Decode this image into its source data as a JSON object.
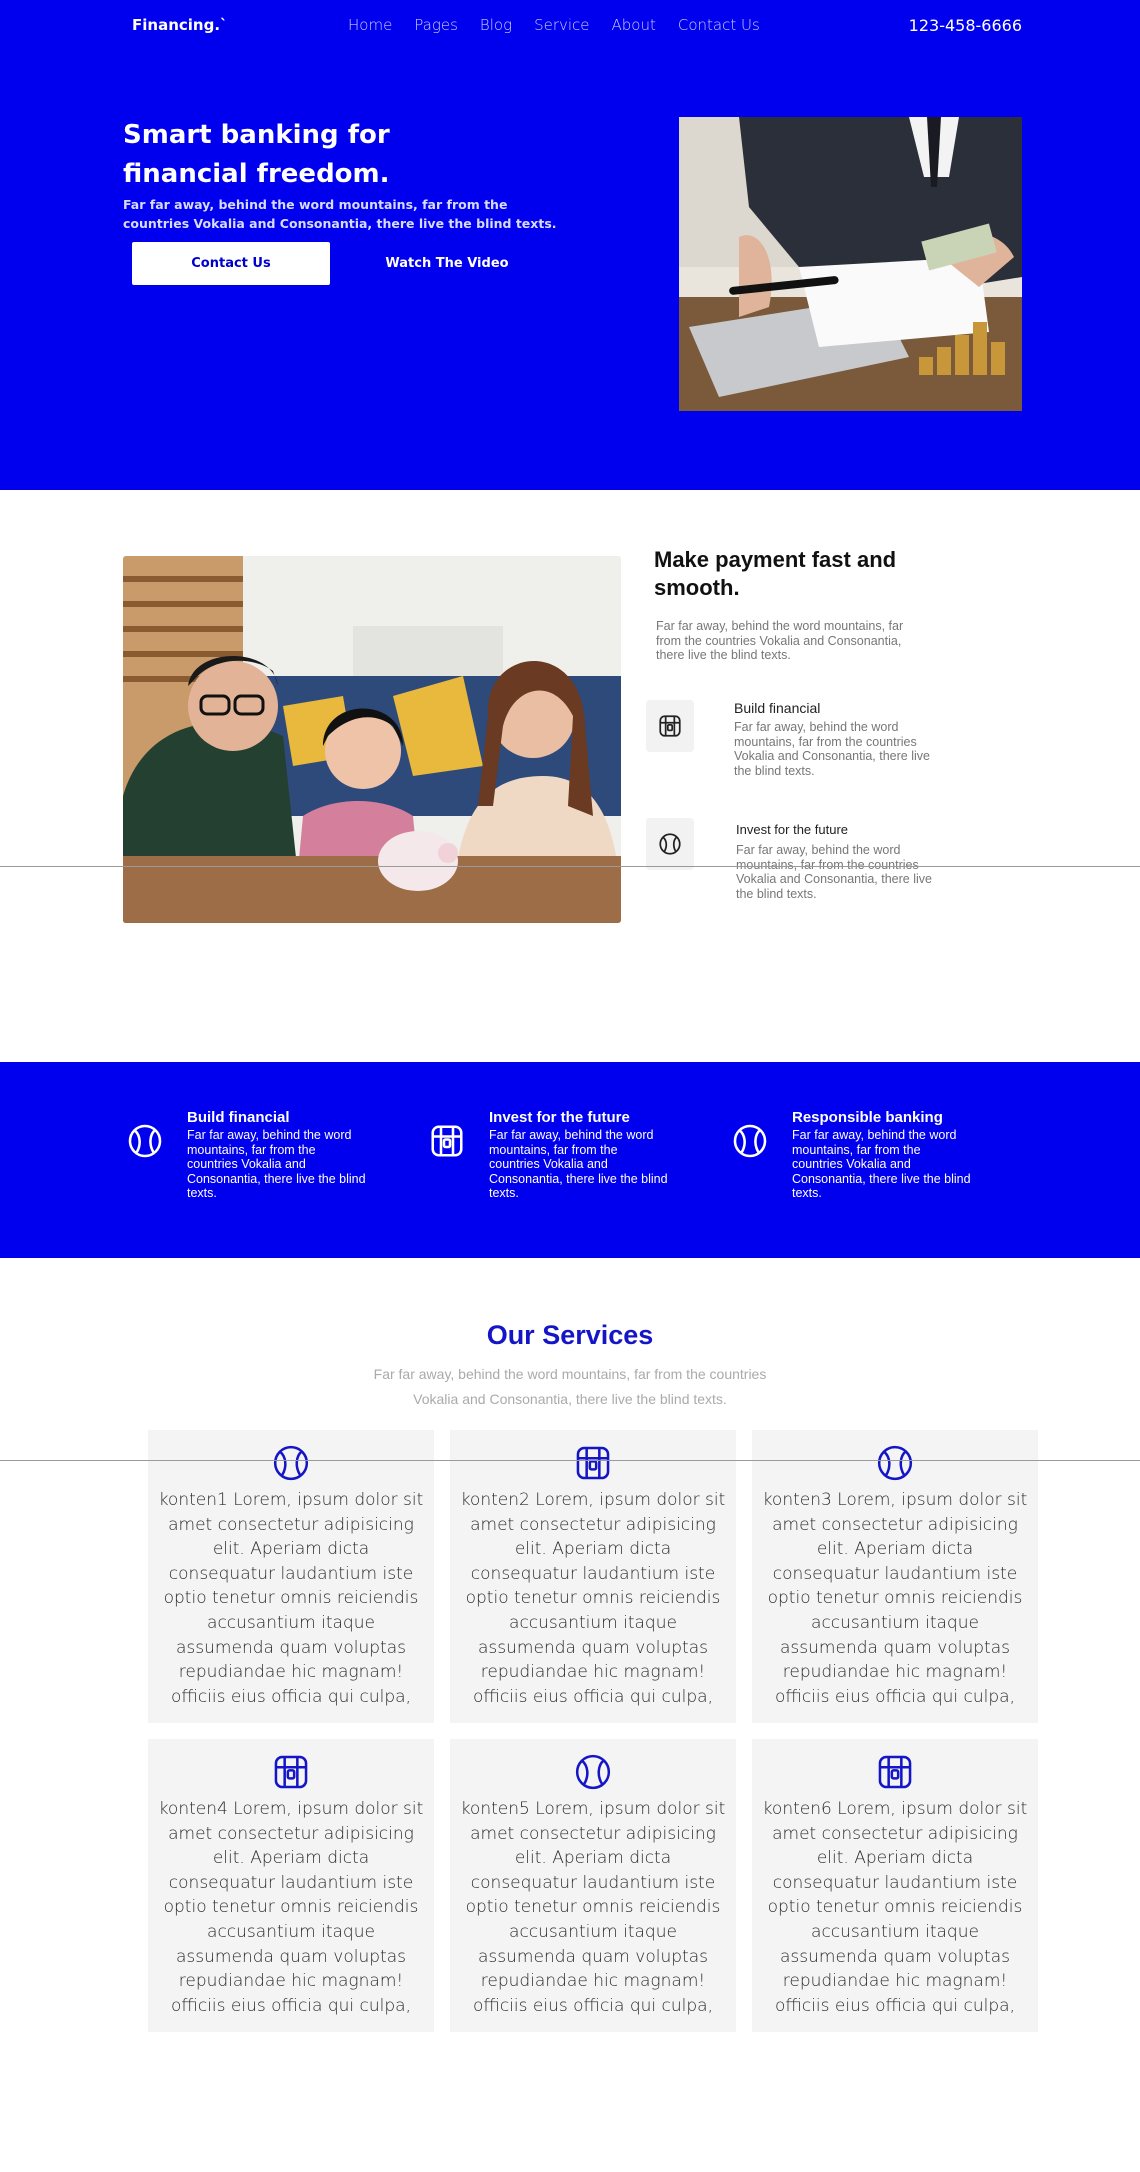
{
  "colors": {
    "brand_blue": "#0000ee",
    "heading_blue": "#1515c8",
    "card_bg": "#f4f4f4"
  },
  "header": {
    "brand": "Financing.`",
    "nav": [
      "Home",
      "Pages",
      "Blog",
      "Service",
      "About",
      "Contact Us"
    ],
    "phone": "123-458-6666"
  },
  "hero": {
    "title": "Smart banking for financial freedom.",
    "subtitle": "Far far away, behind the word mountains, far from the countries Vokalia and Consonantia, there live the blind texts.",
    "contact_button": "Contact Us",
    "video_button": "Watch The Video",
    "image_icon": "businessman-counting-money-photo"
  },
  "about": {
    "image_icon": "family-piggy-bank-photo",
    "title": "Make payment fast and smooth.",
    "text": "Far far away, behind the word mountains, far from the countries Vokalia and Consonantia, there live the blind texts.",
    "features": [
      {
        "icon": "treasure-chest-icon",
        "title": "Build financial",
        "text": "Far far away, behind the word mountains, far from the countries Vokalia and Consonantia, there live the blind texts."
      },
      {
        "icon": "ball-icon",
        "title": "Invest for the future",
        "text": "Far far away, behind the word mountains, far from the countries Vokalia and Consonantia, there live the blind texts."
      }
    ]
  },
  "band": {
    "items": [
      {
        "icon": "ball-icon",
        "title": "Build financial",
        "text": "Far far away, behind the word mountains, far from the countries Vokalia and Consonantia, there live the blind texts."
      },
      {
        "icon": "treasure-chest-icon",
        "title": "Invest for the future",
        "text": "Far far away, behind the word mountains, far from the countries Vokalia and Consonantia, there live the blind texts."
      },
      {
        "icon": "ball-icon",
        "title": "Responsible banking",
        "text": "Far far away, behind the word mountains, far from the countries Vokalia and Consonantia, there live the blind texts."
      }
    ]
  },
  "services": {
    "title": "Our Services",
    "subtitle": "Far far away, behind the word mountains, far from the countries Vokalia and Consonantia, there live the blind texts.",
    "cards": [
      {
        "icon": "ball-icon",
        "text": "konten1 Lorem, ipsum dolor sit amet consectetur adipisicing elit. Aperiam dicta consequatur laudantium iste optio tenetur omnis reiciendis accusantium itaque assumenda quam voluptas repudiandae hic magnam! officiis eius officia qui culpa,"
      },
      {
        "icon": "treasure-chest-icon",
        "text": "konten2 Lorem, ipsum dolor sit amet consectetur adipisicing elit. Aperiam dicta consequatur laudantium iste optio tenetur omnis reiciendis accusantium itaque assumenda quam voluptas repudiandae hic magnam! officiis eius officia qui culpa,"
      },
      {
        "icon": "ball-icon",
        "text": "konten3 Lorem, ipsum dolor sit amet consectetur adipisicing elit. Aperiam dicta consequatur laudantium iste optio tenetur omnis reiciendis accusantium itaque assumenda quam voluptas repudiandae hic magnam! officiis eius officia qui culpa,"
      },
      {
        "icon": "treasure-chest-icon",
        "text": "konten4 Lorem, ipsum dolor sit amet consectetur adipisicing elit. Aperiam dicta consequatur laudantium iste optio tenetur omnis reiciendis accusantium itaque assumenda quam voluptas repudiandae hic magnam! officiis eius officia qui culpa,"
      },
      {
        "icon": "ball-icon",
        "text": "konten5 Lorem, ipsum dolor sit amet consectetur adipisicing elit. Aperiam dicta consequatur laudantium iste optio tenetur omnis reiciendis accusantium itaque assumenda quam voluptas repudiandae hic magnam! officiis eius officia qui culpa,"
      },
      {
        "icon": "treasure-chest-icon",
        "text": "konten6 Lorem, ipsum dolor sit amet consectetur adipisicing elit. Aperiam dicta consequatur laudantium iste optio tenetur omnis reiciendis accusantium itaque assumenda quam voluptas repudiandae hic magnam! officiis eius officia qui culpa,"
      }
    ]
  }
}
